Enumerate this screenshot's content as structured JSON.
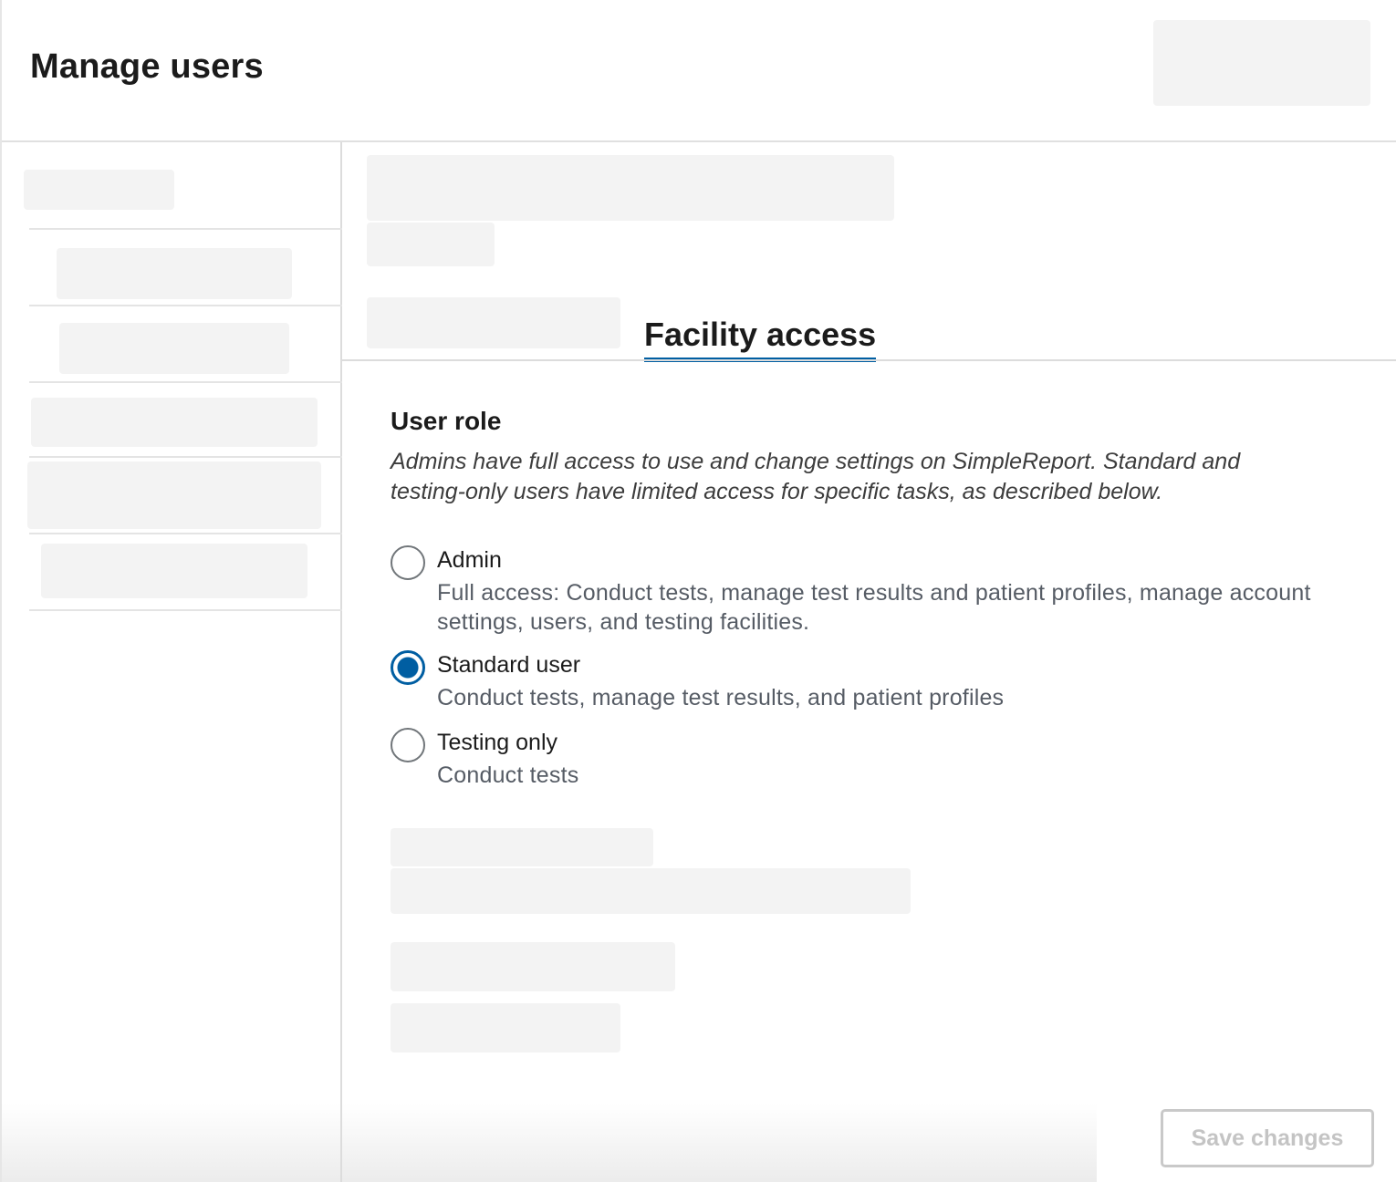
{
  "header": {
    "title": "Manage users"
  },
  "tabs": {
    "active_label": "Facility access"
  },
  "user_role": {
    "heading": "User role",
    "description": "Admins have full access to use and change settings on SimpleReport. Standard and testing-only users have limited access for specific tasks, as described below.",
    "options": [
      {
        "label": "Admin",
        "description": "Full access: Conduct tests, manage test results and patient profiles, manage account settings, users, and testing facilities.",
        "checked": false
      },
      {
        "label": "Standard user",
        "description": "Conduct tests, manage test results, and patient profiles",
        "checked": true
      },
      {
        "label": "Testing only",
        "description": "Conduct tests",
        "checked": false
      }
    ]
  },
  "footer": {
    "save_label": "Save changes",
    "save_disabled": true
  },
  "colors": {
    "accent": "#005ea2",
    "skeleton": "#f3f3f3",
    "muted_text": "#565c65"
  }
}
